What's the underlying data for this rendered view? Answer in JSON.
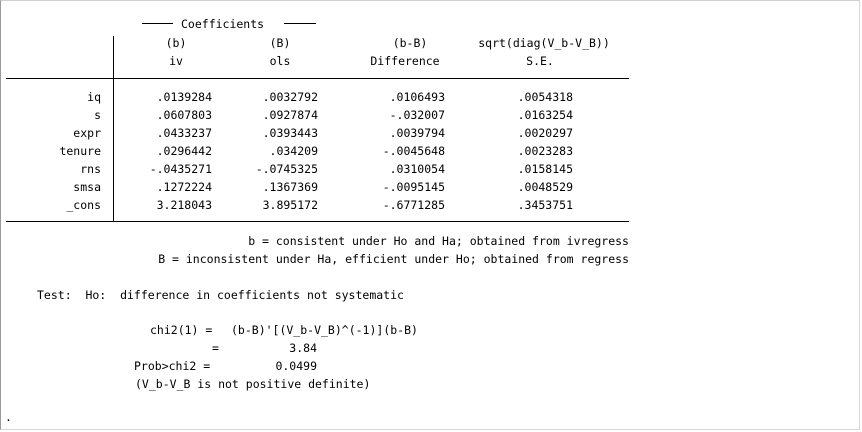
{
  "header": {
    "group_title": "Coefficients",
    "columns": [
      {
        "top": "(b)",
        "bottom": "iv"
      },
      {
        "top": "(B)",
        "bottom": "ols"
      },
      {
        "top": "(b-B)",
        "bottom": "Difference"
      },
      {
        "top": "sqrt(diag(V_b-V_B))",
        "bottom": "S.E."
      }
    ]
  },
  "rows": [
    {
      "name": "iq",
      "b": ".0139284",
      "B": ".0032792",
      "diff": ".0106493",
      "se": ".0054318"
    },
    {
      "name": "s",
      "b": ".0607803",
      "B": ".0927874",
      "diff": "-.032007",
      "se": ".0163254"
    },
    {
      "name": "expr",
      "b": ".0433237",
      "B": ".0393443",
      "diff": ".0039794",
      "se": ".0020297"
    },
    {
      "name": "tenure",
      "b": ".0296442",
      "B": ".034209",
      "diff": "-.0045648",
      "se": ".0023283"
    },
    {
      "name": "rns",
      "b": "-.0435271",
      "B": "-.0745325",
      "diff": ".0310054",
      "se": ".0158145"
    },
    {
      "name": "smsa",
      "b": ".1272224",
      "B": ".1367369",
      "diff": "-.0095145",
      "se": ".0048529"
    },
    {
      "name": "_cons",
      "b": "3.218043",
      "B": "3.895172",
      "diff": "-.6771285",
      "se": ".3453751"
    }
  ],
  "notes": {
    "b_line": "b = consistent under Ho and Ha; obtained from ivregress",
    "B_line": "B = inconsistent under Ha, efficient under Ho; obtained from regress"
  },
  "test": {
    "label": "Test:  Ho:  difference in coefficients not systematic",
    "chi2_label": "chi2(1) = ",
    "chi2_formula": "(b-B)'[(V_b-V_B)^(-1)](b-B)",
    "eq": "=",
    "chi2_value": "3.84",
    "prob_label": "Prob>chi2 =",
    "prob_value": "0.0499",
    "note": "(V_b-V_B is not positive definite)"
  },
  "prompt": "."
}
